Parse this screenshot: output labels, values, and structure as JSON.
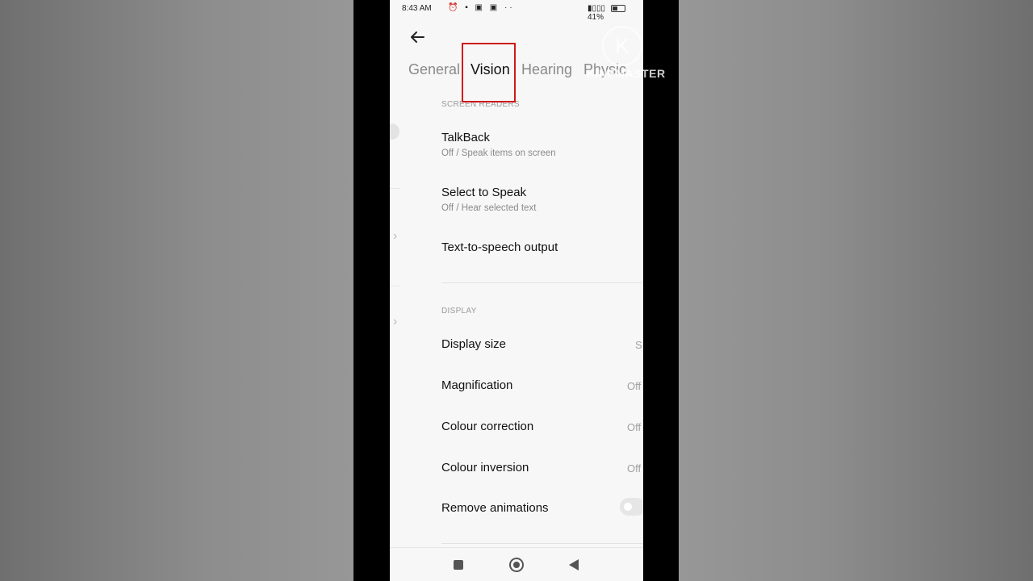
{
  "status_bar": {
    "time": "8:43 AM",
    "notification_icons": "⏰ ▪ ▣ ▣ ··",
    "battery": "41%"
  },
  "tabs": [
    {
      "label": "General"
    },
    {
      "label": "Vision"
    },
    {
      "label": "Hearing"
    },
    {
      "label": "Physic"
    }
  ],
  "watermark": {
    "text": "KINEMASTER",
    "logo_letter": "K"
  },
  "sections": {
    "screen_readers": {
      "label": "SCREEN READERS",
      "items": [
        {
          "title": "TalkBack",
          "subtitle": "Off / Speak items on screen"
        },
        {
          "title": "Select to Speak",
          "subtitle": "Off / Hear selected text"
        },
        {
          "title": "Text-to-speech output"
        }
      ]
    },
    "display": {
      "label": "DISPLAY",
      "items": [
        {
          "title": "Display size",
          "value": "S"
        },
        {
          "title": "Magnification",
          "value": "Off"
        },
        {
          "title": "Colour correction",
          "value": "Off"
        },
        {
          "title": "Colour inversion",
          "value": "Off"
        },
        {
          "title": "Remove animations",
          "toggle": false
        }
      ]
    }
  },
  "colors": {
    "highlight_box": "#d01818"
  }
}
